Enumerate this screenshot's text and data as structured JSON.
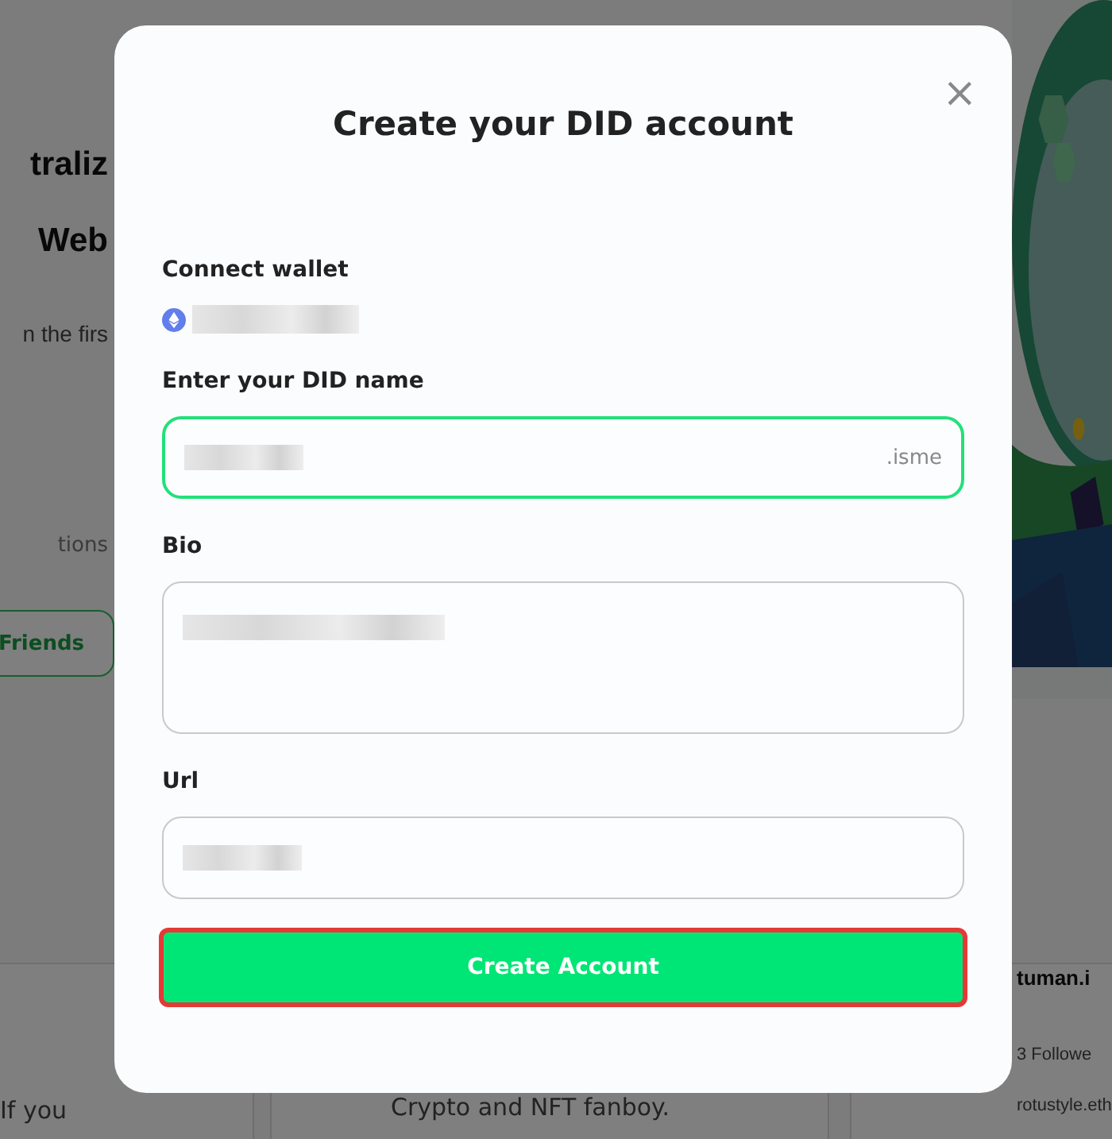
{
  "background": {
    "texts": [
      {
        "kind": "heading",
        "text": "traliz"
      },
      {
        "kind": "heading",
        "text": "Web"
      },
      {
        "kind": "lead",
        "text": "n the firs"
      },
      {
        "kind": "small",
        "text": "tions"
      },
      {
        "kind": "card-text",
        "text": "If you"
      },
      {
        "kind": "card-text",
        "text": "Crypto and NFT fanboy."
      },
      {
        "kind": "card-title",
        "text": "tuman.i"
      },
      {
        "kind": "card-text",
        "text": "3 Followe"
      },
      {
        "kind": "card-text",
        "text": "rotustyle.eth"
      }
    ],
    "button": "Friends"
  },
  "dialog": {
    "title": "Create your DID account",
    "close": "×",
    "fields": [
      {
        "kind": "wallet",
        "label": "Connect wallet"
      },
      {
        "kind": "input",
        "label": "Enter your DID name",
        "suffix": ".isme",
        "focused": true
      },
      {
        "kind": "textarea",
        "label": "Bio",
        "focused": false
      },
      {
        "kind": "input",
        "label": "Url",
        "focused": false
      }
    ],
    "submit": {
      "label": "Create Account",
      "highlighted": true
    }
  }
}
